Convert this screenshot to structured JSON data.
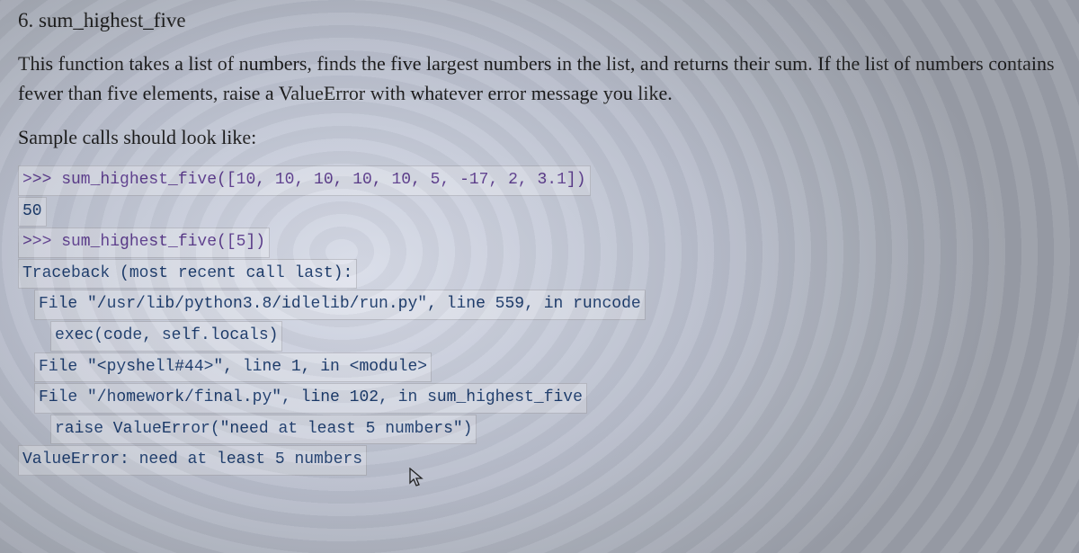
{
  "heading": "6. sum_highest_five",
  "description": "This function takes a list of numbers, finds the five largest numbers in the list, and returns their sum. If the list of numbers contains fewer than five elements, raise a ValueError with whatever error message you like.",
  "sample_lead": "Sample calls should look like:",
  "code": {
    "l1": ">>> sum_highest_five([10, 10, 10, 10, 10, 5, -17, 2, 3.1])",
    "l2": "50",
    "l3": ">>> sum_highest_five([5])",
    "l4": "Traceback (most recent call last):",
    "l5": "File \"/usr/lib/python3.8/idlelib/run.py\", line 559, in runcode",
    "l6": "exec(code, self.locals)",
    "l7": "File \"<pyshell#44>\", line 1, in <module>",
    "l8": "File \"/homework/final.py\", line 102, in sum_highest_five",
    "l9": "raise ValueError(\"need at least 5 numbers\")",
    "l10": "ValueError: need at least 5 numbers"
  }
}
